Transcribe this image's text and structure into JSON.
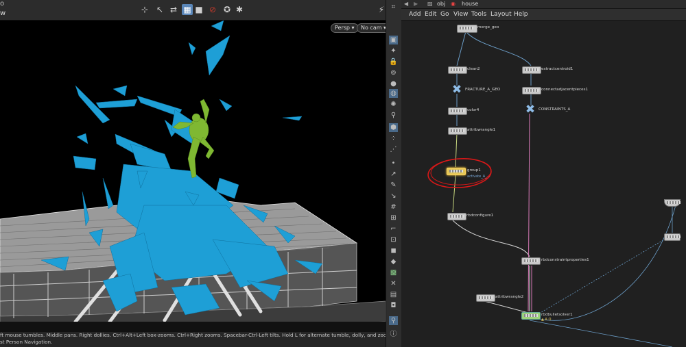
{
  "viewport": {
    "title": "o",
    "label": "w",
    "camera_buttons": [
      "Persp ▾",
      "No cam ▾"
    ],
    "status_lines": [
      "ft mouse tumbles. Middle pans. Right dollies. Ctrl+Alt+Left box-zooms. Ctrl+Right zooms. Spacebar-Ctrl-Left tilts. Hold L for alternate tumble, dolly, and zoom.       M or Alt+M for",
      "st Person Navigation."
    ]
  },
  "network": {
    "path": {
      "context": "obj",
      "object": "house"
    },
    "menu": [
      "Add",
      "Edit",
      "Go",
      "View",
      "Tools",
      "Layout",
      "Help"
    ],
    "nodes": {
      "merge_geo": "merge_geo",
      "clean2": "clean2",
      "extractcentroid1": "extractcentroid1",
      "fracture_a_geo": "FRACTURE_A_GEO",
      "connectadjacentpieces1": "connectadjacentpieces1",
      "color4": "color4",
      "constraints_a": "CONSTRAINTS_A",
      "attribwrangle1": "attribwrangle1",
      "group1": "group1",
      "group1_sub": "activate_A_...",
      "rbdconfigure1": "rbdconfigure1",
      "rbdconstraintproperties1": "rbdconstraintproperties1",
      "attribwrangle2": "attribwrangle2",
      "rbdbulletsolver1": "rbdbulletsolver1",
      "rbdbulletsolver1_flags": "▲ A O"
    }
  },
  "colors": {
    "shard_blue": "#1e9fd6",
    "hulk_green": "#7fb832",
    "selected_node": "#e4c75a",
    "annotation_red": "#d81818",
    "wire_pink": "#d87ab8"
  }
}
